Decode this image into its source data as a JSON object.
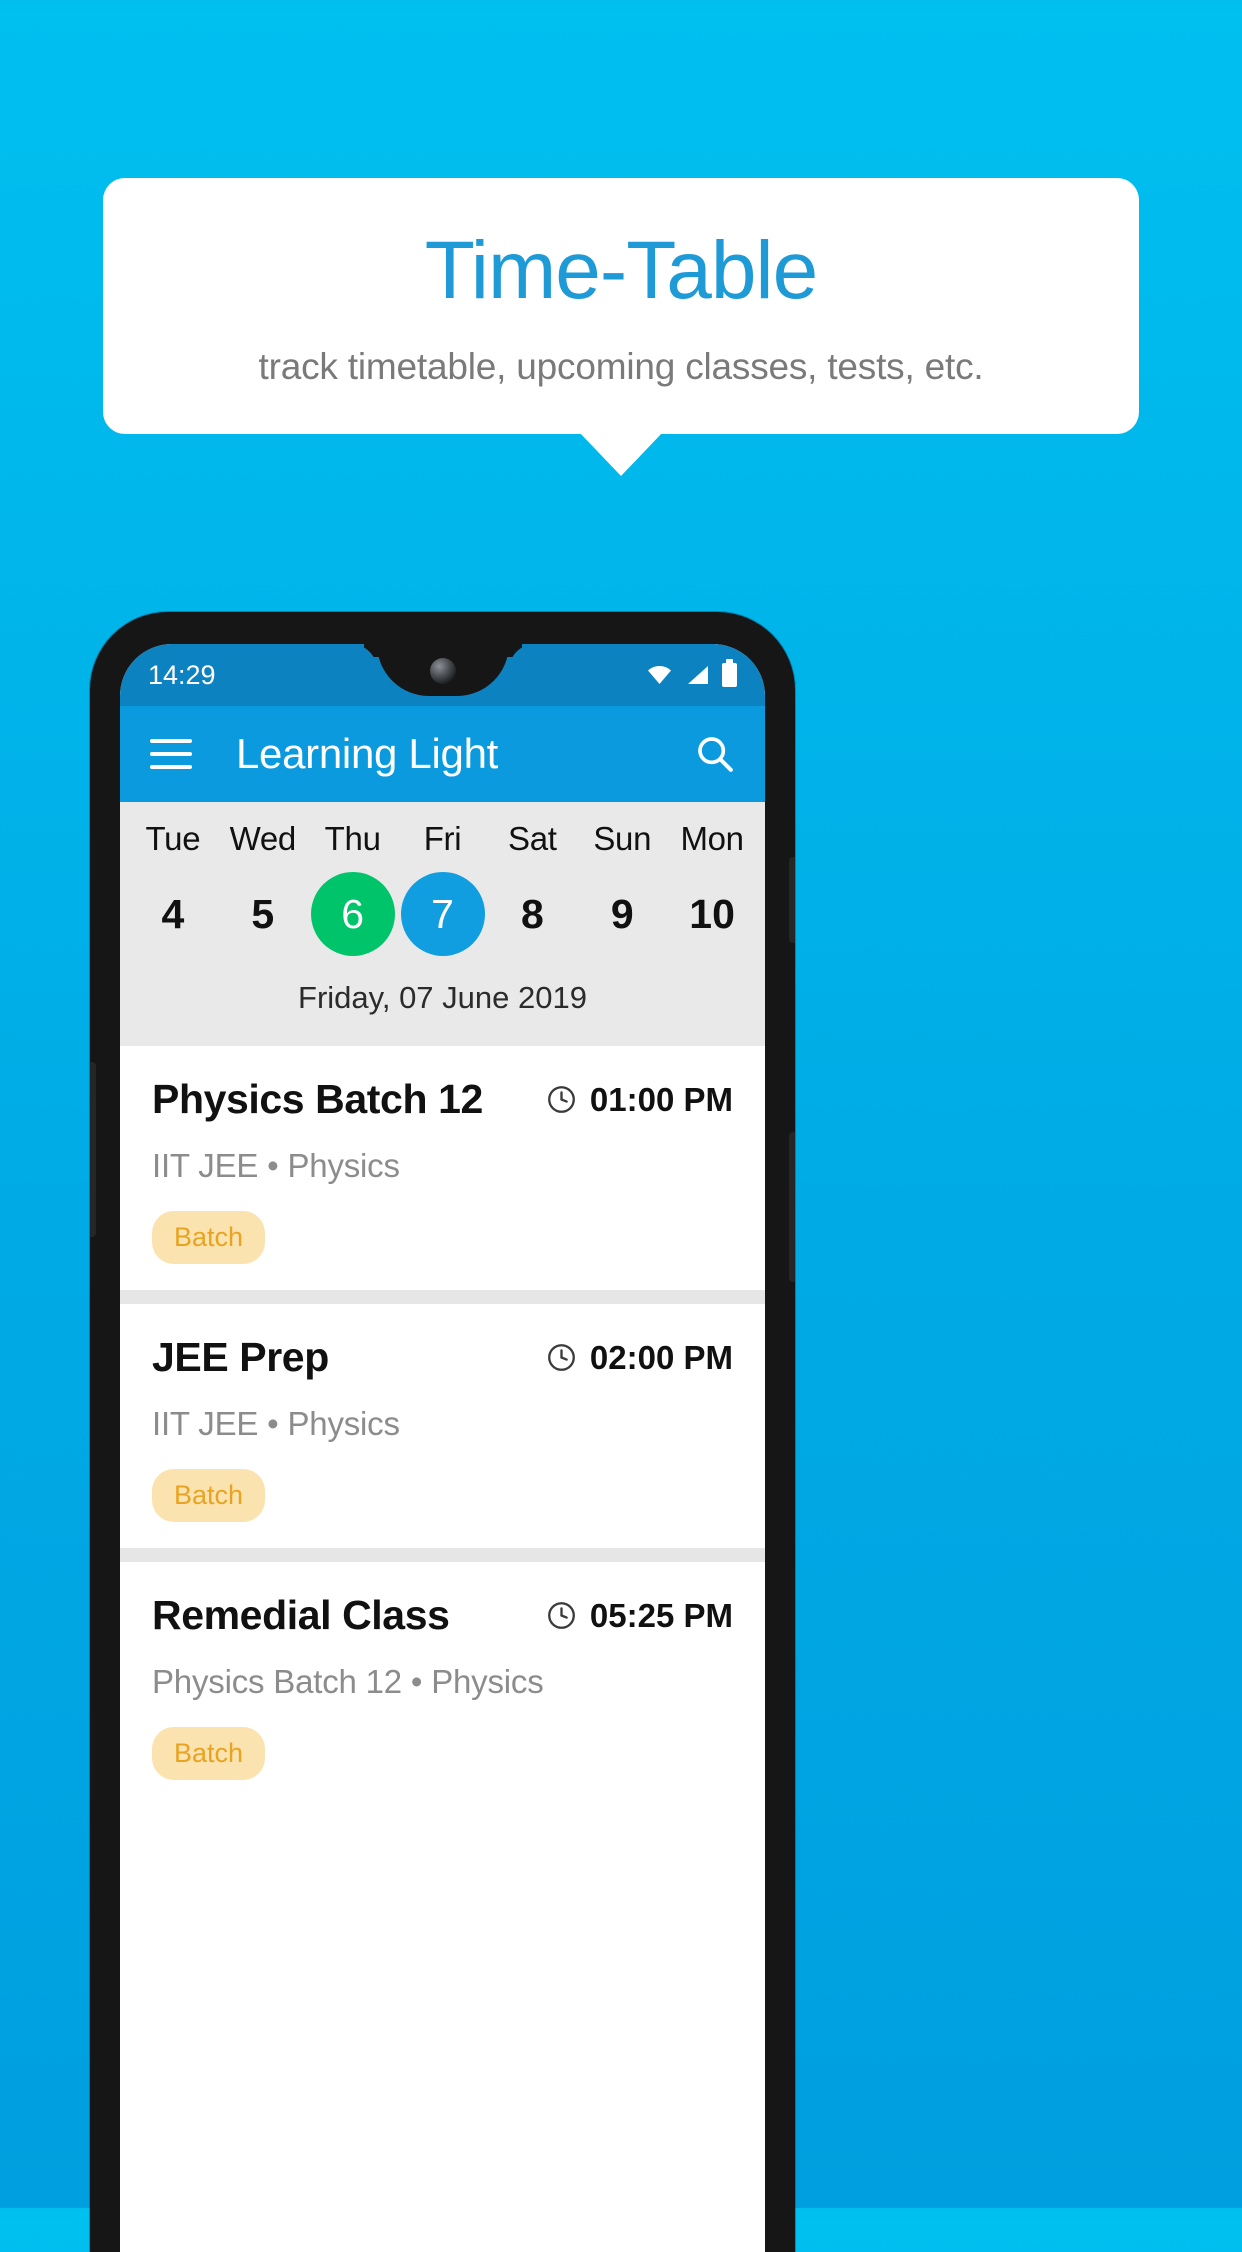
{
  "promo": {
    "title": "Time-Table",
    "subtitle": "track timetable, upcoming classes, tests, etc.",
    "title_color": "#1e9bd7",
    "subtitle_color": "#7a7a7a",
    "background_color": "#00b6eb"
  },
  "phone": {
    "statusbar": {
      "time": "14:29",
      "icons": [
        "wifi-icon",
        "signal-icon",
        "battery-icon"
      ],
      "background_color": "#0c82c0"
    },
    "appbar": {
      "menu_icon": "hamburger-menu-icon",
      "title": "Learning Light",
      "search_icon": "search-icon",
      "background_color": "#0c9ade"
    },
    "daystrip": {
      "days": [
        {
          "name": "Tue",
          "num": "4",
          "state": ""
        },
        {
          "name": "Wed",
          "num": "5",
          "state": ""
        },
        {
          "name": "Thu",
          "num": "6",
          "state": "today"
        },
        {
          "name": "Fri",
          "num": "7",
          "state": "selected"
        },
        {
          "name": "Sat",
          "num": "8",
          "state": ""
        },
        {
          "name": "Sun",
          "num": "9",
          "state": ""
        },
        {
          "name": "Mon",
          "num": "10",
          "state": ""
        }
      ],
      "today_color": "#00c46a",
      "selected_color": "#109ee0",
      "date_label": "Friday, 07 June 2019",
      "background_color": "#e9e9e9"
    },
    "classes": [
      {
        "title": "Physics Batch 12",
        "time": "01:00 PM",
        "time_icon": "clock-icon",
        "subtitle": "IIT JEE • Physics",
        "chip": "Batch"
      },
      {
        "title": "JEE Prep",
        "time": "02:00 PM",
        "time_icon": "clock-icon",
        "subtitle": "IIT JEE • Physics",
        "chip": "Batch"
      },
      {
        "title": "Remedial Class",
        "time": "05:25 PM",
        "time_icon": "clock-icon",
        "subtitle": "Physics Batch 12 • Physics",
        "chip": "Batch"
      }
    ],
    "chip_colors": {
      "background": "#fbe3af",
      "text": "#e8a322"
    }
  }
}
